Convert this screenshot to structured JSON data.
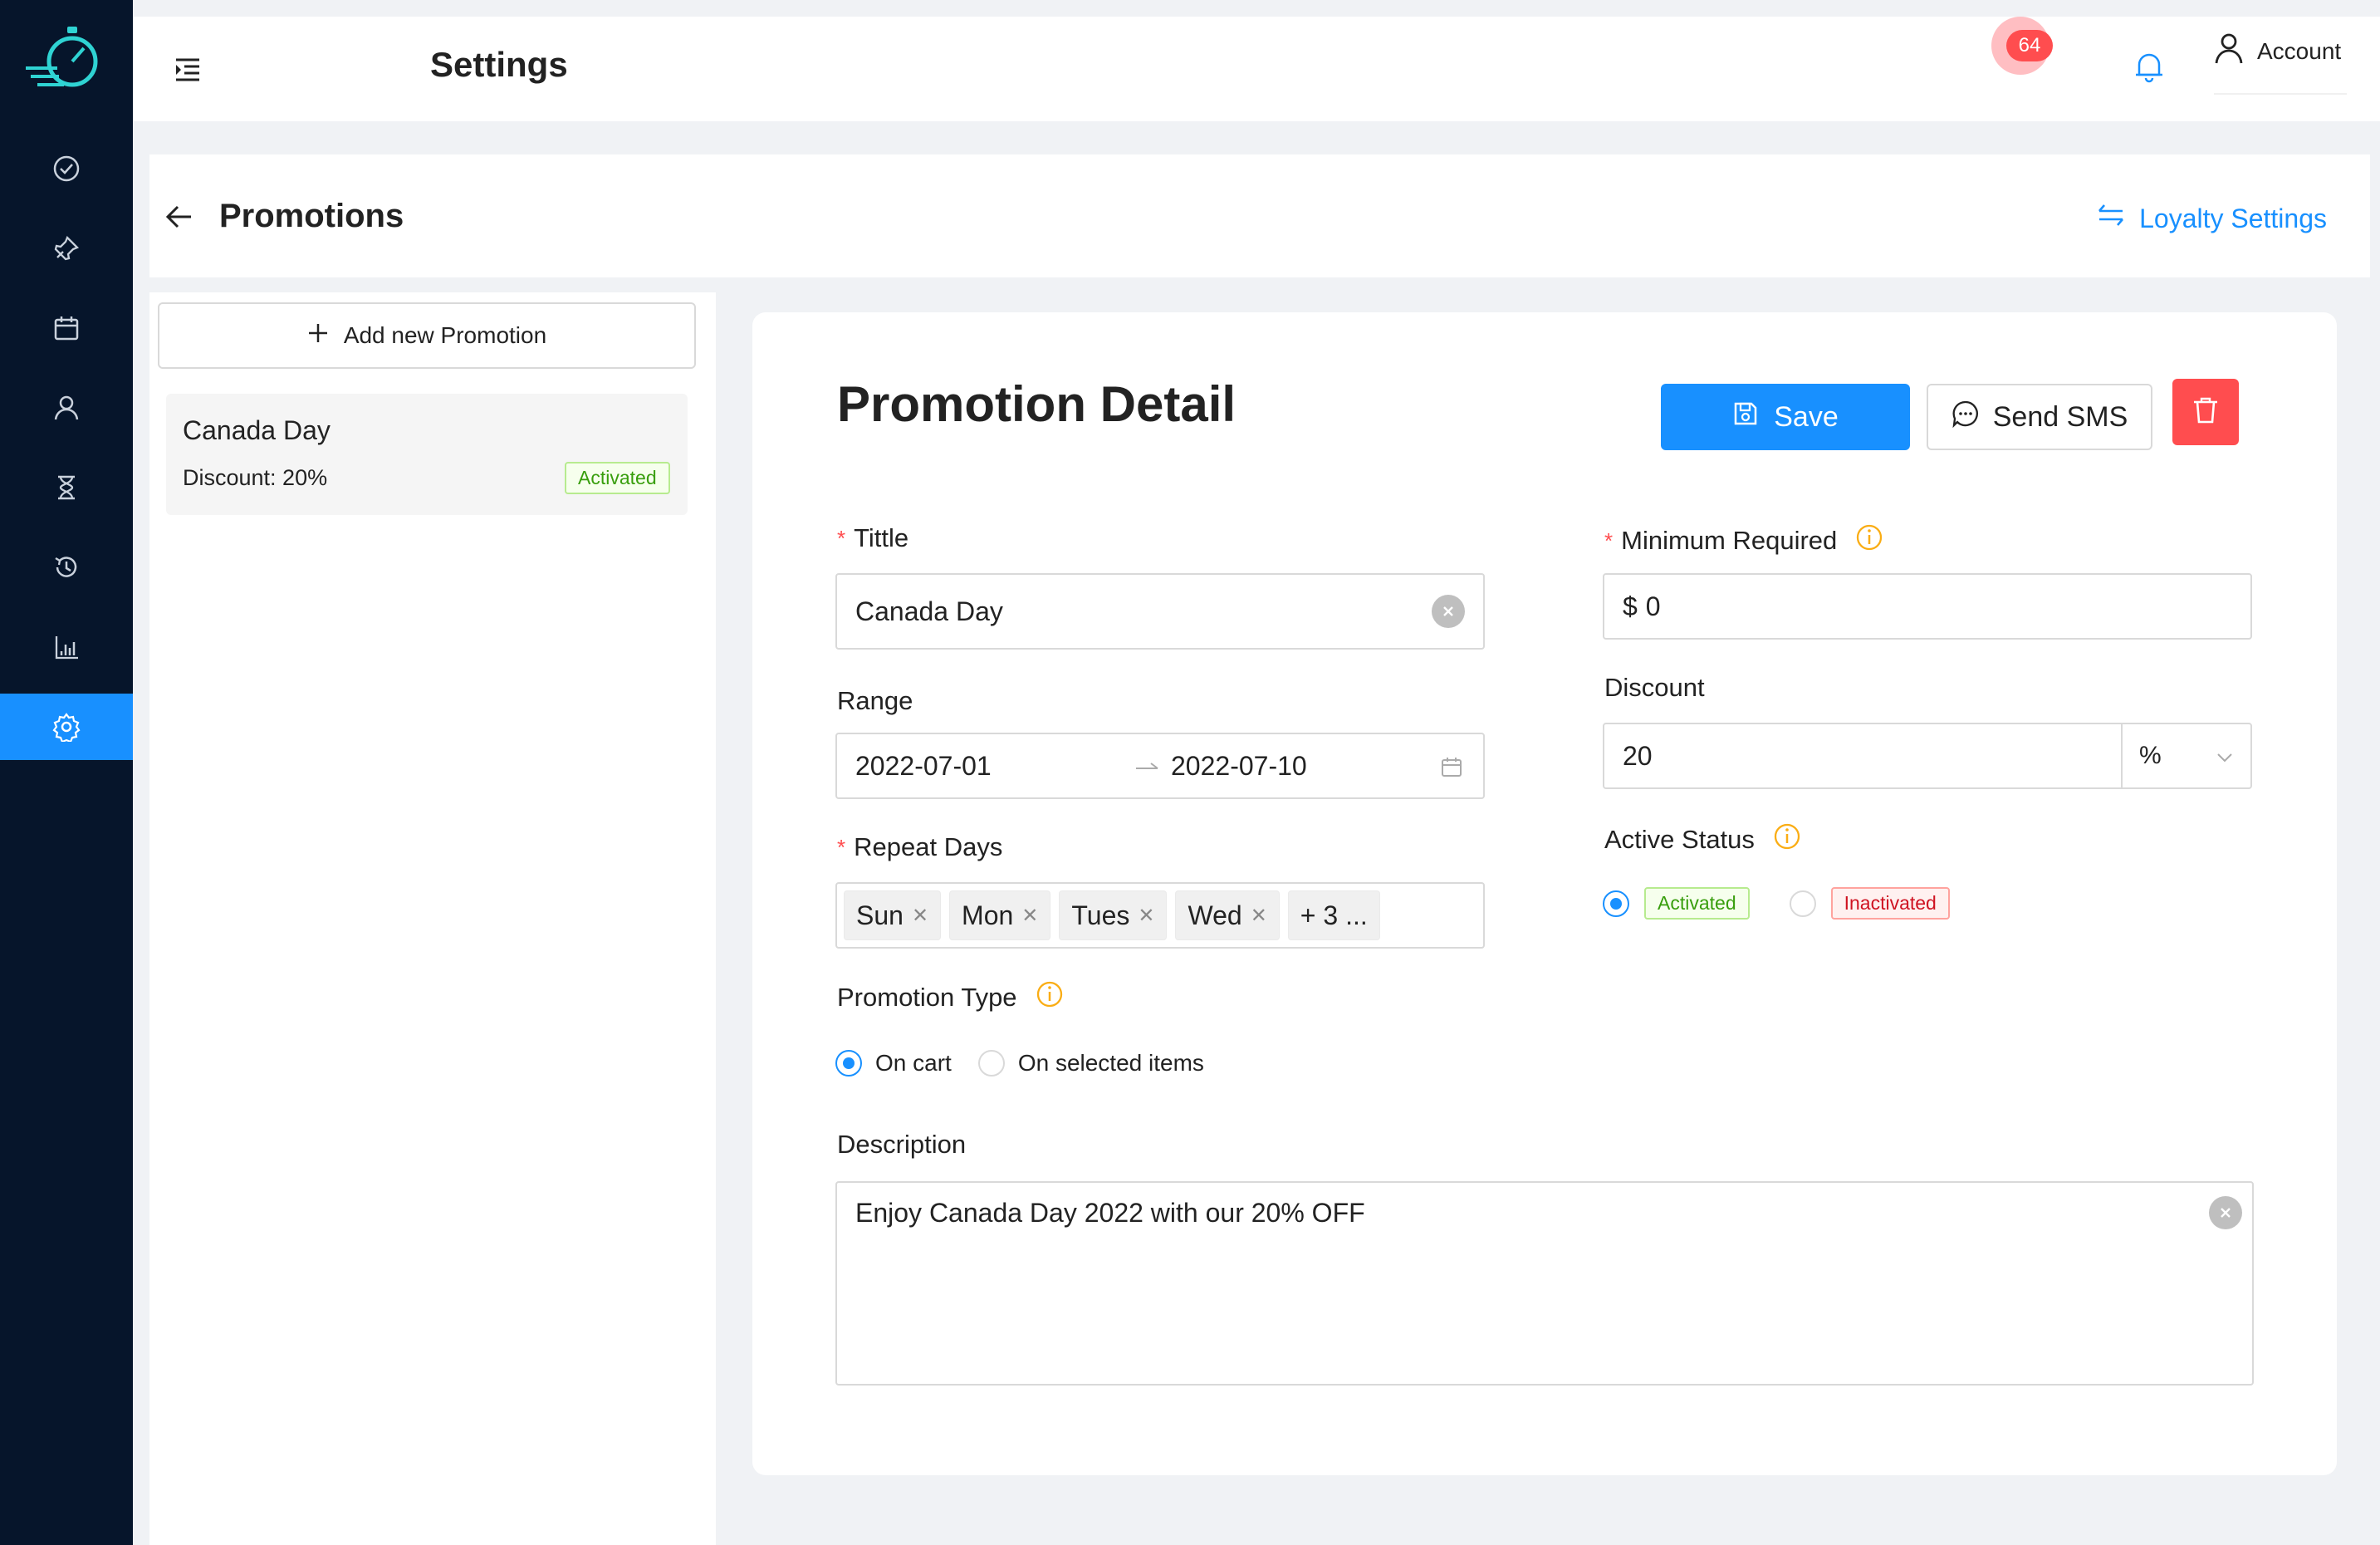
{
  "header": {
    "title": "Settings",
    "notification_count": "64",
    "account_label": "Account"
  },
  "nav": {
    "items": [
      "check-circle-icon",
      "pin-icon",
      "calendar-icon",
      "user-icon",
      "hourglass-icon",
      "history-icon",
      "bar-chart-icon",
      "gear-icon"
    ],
    "active": "gear-icon"
  },
  "promotions": {
    "title": "Promotions",
    "loyalty_link": "Loyalty Settings",
    "add_button": "Add new Promotion",
    "list": [
      {
        "name": "Canada Day",
        "discount": "Discount: 20%",
        "status": "Activated"
      }
    ]
  },
  "detail": {
    "title": "Promotion Detail",
    "save_label": "Save",
    "sms_label": "Send SMS",
    "title_label": "Tittle",
    "title_value": "Canada Day",
    "range_label": "Range",
    "range_start": "2022-07-01",
    "range_end": "2022-07-10",
    "repeat_label": "Repeat Days",
    "repeat_days": [
      "Sun",
      "Mon",
      "Tues",
      "Wed"
    ],
    "repeat_more": "+ 3 ...",
    "type_label": "Promotion Type",
    "type_options": [
      "On cart",
      "On selected items"
    ],
    "type_selected": "On cart",
    "min_label": "Minimum Required",
    "min_prefix": "$",
    "min_value": "0",
    "discount_label": "Discount",
    "discount_value": "20",
    "discount_unit": "%",
    "status_label": "Active Status",
    "status_options": [
      "Activated",
      "Inactivated"
    ],
    "status_selected": "Activated",
    "description_label": "Description",
    "description_value": "Enjoy Canada Day 2022 with our 20% OFF"
  },
  "colors": {
    "primary": "#1890ff",
    "danger": "#ff4d4f",
    "sidebar": "#06152b",
    "success": "#389e0d",
    "warning": "#faad14"
  }
}
